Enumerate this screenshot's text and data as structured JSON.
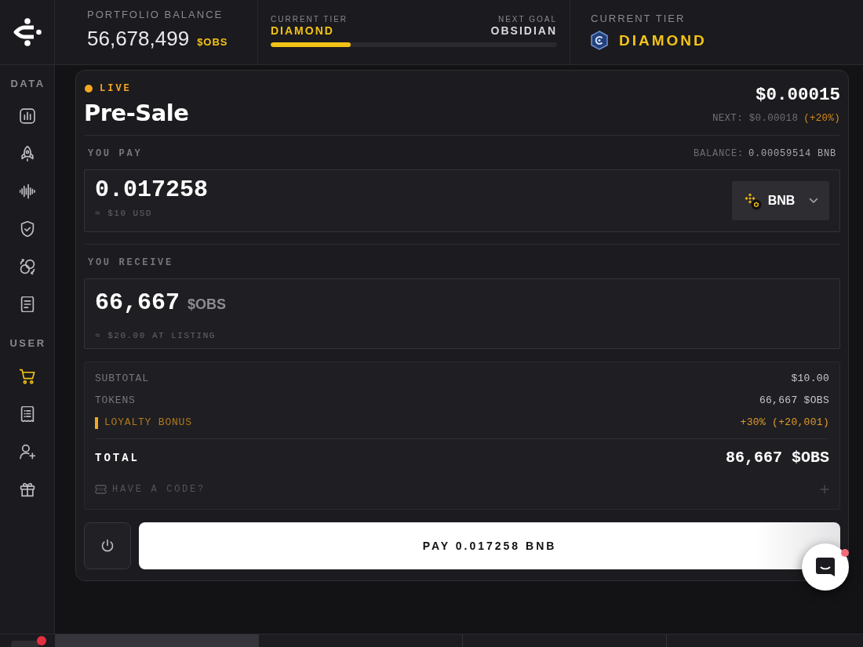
{
  "header": {
    "portfolio": {
      "label": "PORTFOLIO BALANCE",
      "value": "56,678,499",
      "unit": "$OBS"
    },
    "tier_progress": {
      "current_label": "CURRENT TIER",
      "current": "DIAMOND",
      "next_label": "NEXT GOAL",
      "next": "OBSIDIAN",
      "level": 0.28
    },
    "current_tier": {
      "label": "CURRENT TIER",
      "value": "DIAMOND"
    }
  },
  "sidebar": {
    "sections": [
      {
        "title": "DATA",
        "items": [
          {
            "selected": false
          },
          {
            "selected": false
          },
          {
            "selected": false
          },
          {
            "selected": false
          },
          {
            "selected": false
          },
          {
            "selected": false
          }
        ]
      },
      {
        "title": "USER",
        "items": [
          {
            "selected": true
          },
          {
            "selected": false
          },
          {
            "selected": false
          },
          {
            "selected": false
          }
        ]
      }
    ]
  },
  "presale": {
    "status": "LIVE",
    "title": "Pre-Sale",
    "price": "$0.00015",
    "next_price": "NEXT: $0.00018",
    "next_change": "(+20%)"
  },
  "pay": {
    "label": "YOU PAY",
    "balance_label": "BALANCE:",
    "balance_value": "0.00059514 BNB",
    "amount": "0.017258",
    "amount_usd": "≈ $10 USD",
    "token": "BNB"
  },
  "receive": {
    "label": "YOU RECEIVE",
    "amount": "66,667",
    "unit": "$OBS",
    "listing_value": "≈ $20.00 AT LISTING"
  },
  "summary": {
    "rows": [
      {
        "kind": "normal",
        "label": "SUBTOTAL",
        "value": "$10.00"
      },
      {
        "kind": "normal",
        "label": "TOKENS",
        "value": "66,667 $OBS"
      },
      {
        "kind": "bonus",
        "label": "LOYALTY BONUS",
        "value": "+30% (+20,001)"
      }
    ],
    "total_label": "TOTAL",
    "total_value": "86,667 $OBS",
    "code_prompt": "HAVE A CODE?"
  },
  "pay_button": "PAY 0.017258 BNB",
  "bottom_nav": {
    "tabs": [
      {
        "selected": true
      },
      {
        "selected": false
      },
      {
        "selected": false
      },
      {
        "selected": false
      }
    ]
  }
}
